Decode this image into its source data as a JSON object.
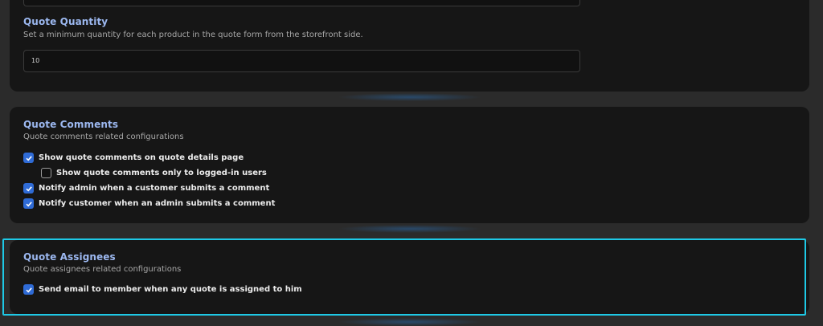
{
  "quote_quantity": {
    "title": "Quote Quantity",
    "description": "Set a minimum quantity for each product in the quote form from the storefront side.",
    "value": "10"
  },
  "quote_comments": {
    "title": "Quote Comments",
    "description": "Quote comments related configurations",
    "options": [
      {
        "label": "Show quote comments on quote details page",
        "checked": true
      },
      {
        "label": "Show quote comments only to logged-in users",
        "checked": false
      },
      {
        "label": "Notify admin when a customer submits a comment",
        "checked": true
      },
      {
        "label": "Notify customer when an admin submits a comment",
        "checked": true
      }
    ]
  },
  "quote_assignees": {
    "title": "Quote Assignees",
    "description": "Quote assignees related configurations",
    "options": [
      {
        "label": "Send email to member when any quote is assigned to him",
        "checked": true
      }
    ]
  },
  "colors": {
    "accent": "#2f6bd6",
    "title": "#9cb8f0",
    "highlight": "#1ec9e6"
  }
}
